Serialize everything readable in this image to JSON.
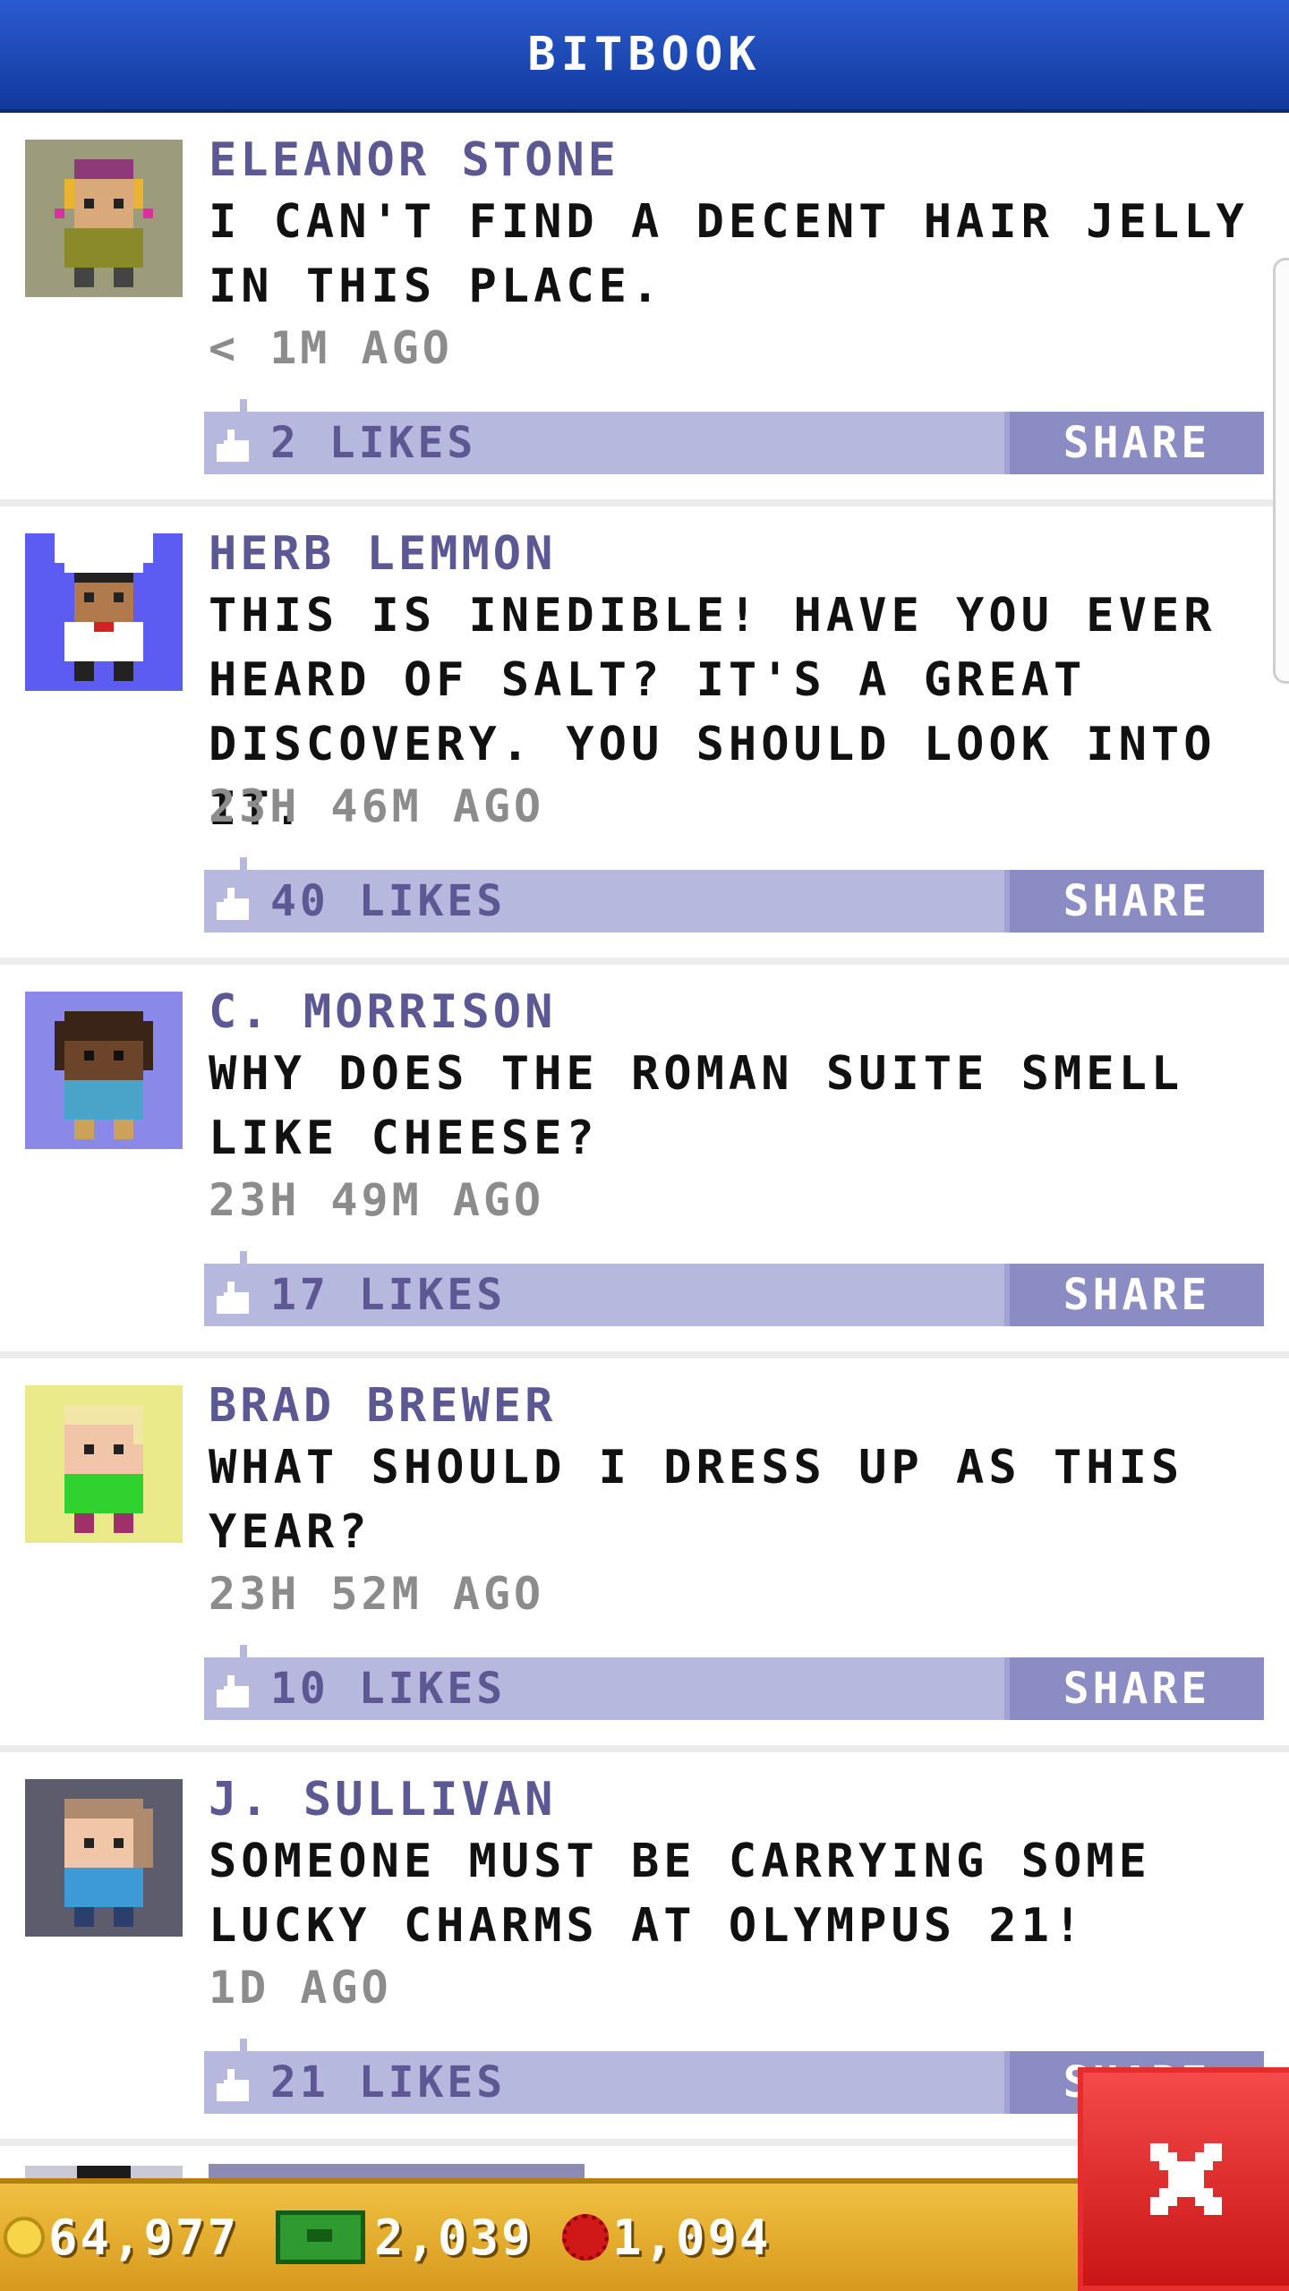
{
  "header": {
    "title": "BITBOOK"
  },
  "posts": [
    {
      "author": "ELEANOR STONE",
      "text": "I CAN'T FIND A DECENT HAIR JELLY IN THIS PLACE.",
      "time": "< 1M AGO",
      "likes": "2 LIKES",
      "share": "SHARE",
      "avatar_bg": "#9c9c7c"
    },
    {
      "author": "HERB LEMMON",
      "text": "THIS IS INEDIBLE! HAVE YOU EVER HEARD OF SALT? IT'S A GREAT DISCOVERY. YOU SHOULD LOOK INTO IT.",
      "time": "23H 46M AGO",
      "likes": "40 LIKES",
      "share": "SHARE",
      "avatar_bg": "#5c5cf2"
    },
    {
      "author": "C. MORRISON",
      "text": "WHY DOES THE ROMAN SUITE SMELL LIKE CHEESE?",
      "time": "23H 49M AGO",
      "likes": "17 LIKES",
      "share": "SHARE",
      "avatar_bg": "#8a89ea"
    },
    {
      "author": "BRAD BREWER",
      "text": "WHAT SHOULD I DRESS UP AS THIS YEAR?",
      "time": "23H 52M AGO",
      "likes": "10 LIKES",
      "share": "SHARE",
      "avatar_bg": "#eaea8a"
    },
    {
      "author": "J. SULLIVAN",
      "text": "SOMEONE MUST BE CARRYING SOME LUCKY CHARMS AT OLYMPUS 21!",
      "time": "1D AGO",
      "likes": "21 LIKES",
      "share": "SHARE",
      "avatar_bg": "#5c5c6c"
    }
  ],
  "footer": {
    "coins": "64,977",
    "bux": "2,039",
    "gems": "1,094"
  },
  "colors": {
    "header": "#1d4bb8",
    "author": "#5c5893",
    "like_bar": "#b7b8dd",
    "share_button": "#8b8cc4",
    "footer": "#e6ac2e",
    "close": "#e02424"
  },
  "icons": [
    "thumb-up-icon",
    "coin-icon",
    "cash-icon",
    "gem-icon",
    "close-icon"
  ]
}
